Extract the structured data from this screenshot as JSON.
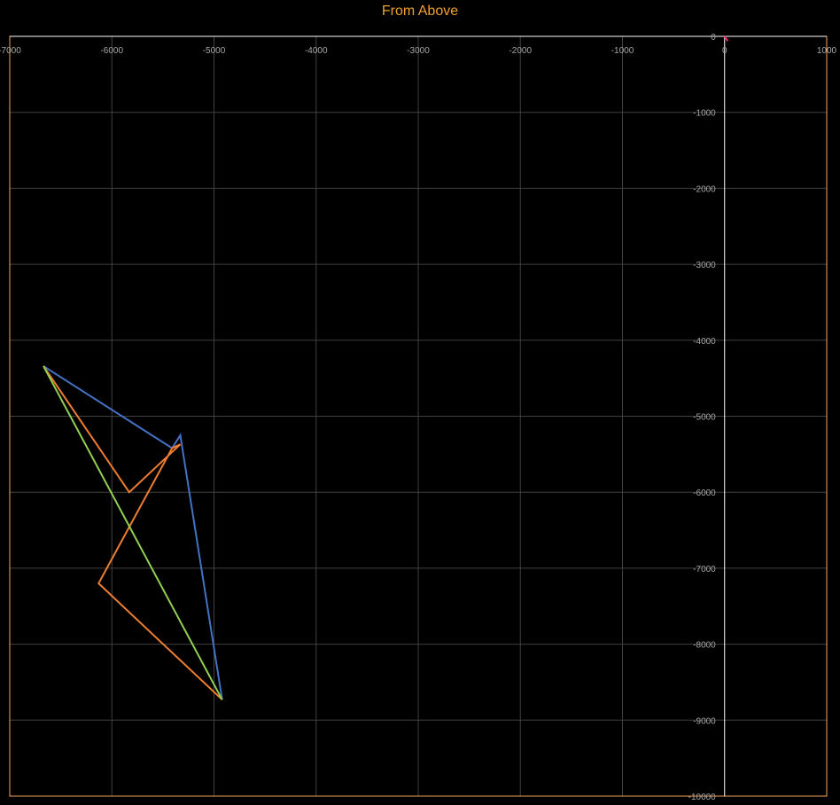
{
  "chart_data": {
    "type": "scatter",
    "title": "From Above",
    "xlabel": "",
    "ylabel": "",
    "xlim": [
      -7000,
      1000
    ],
    "ylim": [
      -10000,
      0
    ],
    "x_ticks": [
      -7000,
      -6000,
      -5000,
      -4000,
      -3000,
      -2000,
      -1000,
      0,
      1000
    ],
    "y_ticks": [
      0,
      -1000,
      -2000,
      -3000,
      -4000,
      -5000,
      -6000,
      -7000,
      -8000,
      -9000,
      -10000
    ],
    "grid": true,
    "series": [
      {
        "color": "#4472c4",
        "points": [
          [
            -6670,
            -4340
          ],
          [
            -5410,
            -5420
          ],
          [
            -5330,
            -5250
          ],
          [
            -4920,
            -8730
          ]
        ]
      },
      {
        "color": "#ed7d31",
        "points": [
          [
            -6670,
            -4340
          ],
          [
            -5830,
            -6000
          ],
          [
            -5330,
            -5370
          ],
          [
            -5410,
            -5420
          ],
          [
            -6130,
            -7200
          ],
          [
            -4920,
            -8730
          ]
        ]
      },
      {
        "color": "#92d050",
        "points": [
          [
            -6670,
            -4340
          ],
          [
            -4920,
            -8730
          ]
        ]
      },
      {
        "color": "#ff2a6d",
        "points": [
          [
            0,
            0
          ],
          [
            30,
            -60
          ]
        ]
      }
    ],
    "colors": {
      "background": "#000000",
      "grid": "#404040",
      "axis": "#ffffff",
      "frame": "#f4a460",
      "title": "#f0a030",
      "tick_labels": "#a6a6a6"
    }
  }
}
